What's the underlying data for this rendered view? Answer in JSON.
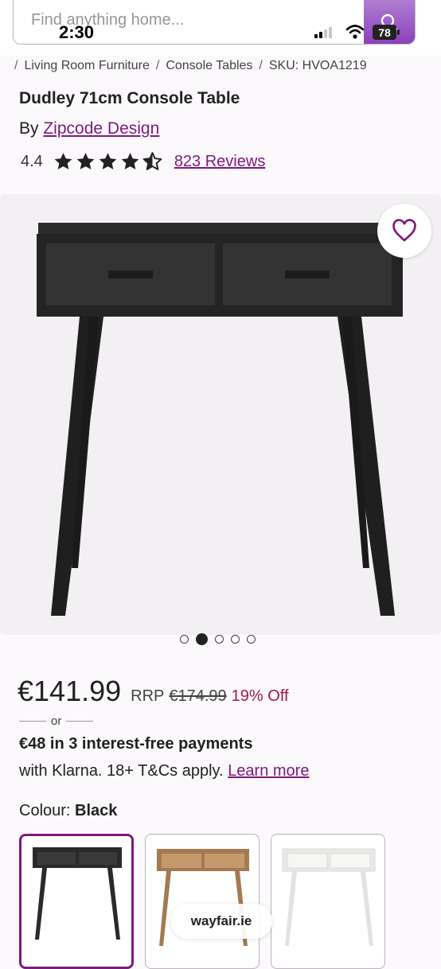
{
  "status_bar": {
    "time": "2:30",
    "battery": "78"
  },
  "search": {
    "placeholder": "Find anything home..."
  },
  "breadcrumb": {
    "items": [
      "Living Room Furniture",
      "Console Tables"
    ],
    "sku": "SKU: HVOA1219"
  },
  "product": {
    "title": "Dudley 71cm Console Table",
    "by_prefix": "By",
    "brand": "Zipcode Design",
    "rating": "4.4",
    "stars": 4.4,
    "reviews": "823 Reviews"
  },
  "gallery": {
    "image_count": 5,
    "active_index": 1
  },
  "pricing": {
    "price": "€141.99",
    "rrp_label": "RRP",
    "rrp_value": "€174.99",
    "discount": "19% Off",
    "or": "or",
    "installment": "€48 in 3 interest-free payments",
    "klarna_text": "with Klarna. 18+ T&Cs apply.",
    "learn_more": "Learn more"
  },
  "colour": {
    "label": "Colour:",
    "selected": "Black",
    "options": [
      {
        "name": "Black",
        "hex": "#2a2a2a"
      },
      {
        "name": "Natural",
        "hex": "#b98a5c"
      },
      {
        "name": "White",
        "hex": "#f4f4f2"
      }
    ]
  },
  "badge": {
    "domain": "wayfair.ie"
  },
  "colors": {
    "brand_purple": "#7f187f",
    "discount_red": "#a3174a",
    "search_button": "#9b54c8"
  }
}
